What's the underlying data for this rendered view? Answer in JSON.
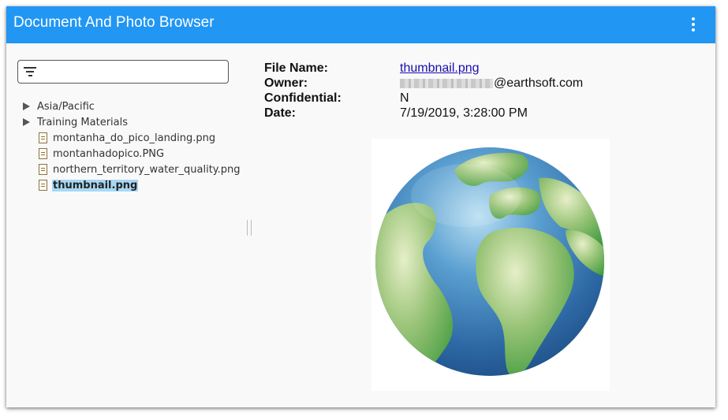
{
  "window": {
    "title": "Document And Photo Browser"
  },
  "filter": {
    "value": "",
    "placeholder": ""
  },
  "tree": {
    "folders": [
      {
        "label": "Asia/Pacific"
      },
      {
        "label": "Training Materials"
      }
    ],
    "files": [
      {
        "label": "montanha_do_pico_landing.png"
      },
      {
        "label": "montanhadopico.PNG"
      },
      {
        "label": "northern_territory_water_quality.png"
      },
      {
        "label": "thumbnail.png"
      }
    ],
    "selected_index": 3
  },
  "details": {
    "file_name_label": "File Name:",
    "file_name": "thumbnail.png",
    "owner_label": "Owner:",
    "owner_domain": "@earthsoft.com",
    "confidential_label": "Confidential:",
    "confidential": "N",
    "date_label": "Date:",
    "date": "7/19/2019, 3:28:00 PM"
  },
  "colors": {
    "titlebar": "#2196f3",
    "selection": "#a7d8f5",
    "link": "#1a0dab"
  },
  "icons": {
    "menu": "kebab-menu-icon",
    "filter": "filter-icon",
    "folder": "triangle-right-icon",
    "file": "document-icon"
  }
}
